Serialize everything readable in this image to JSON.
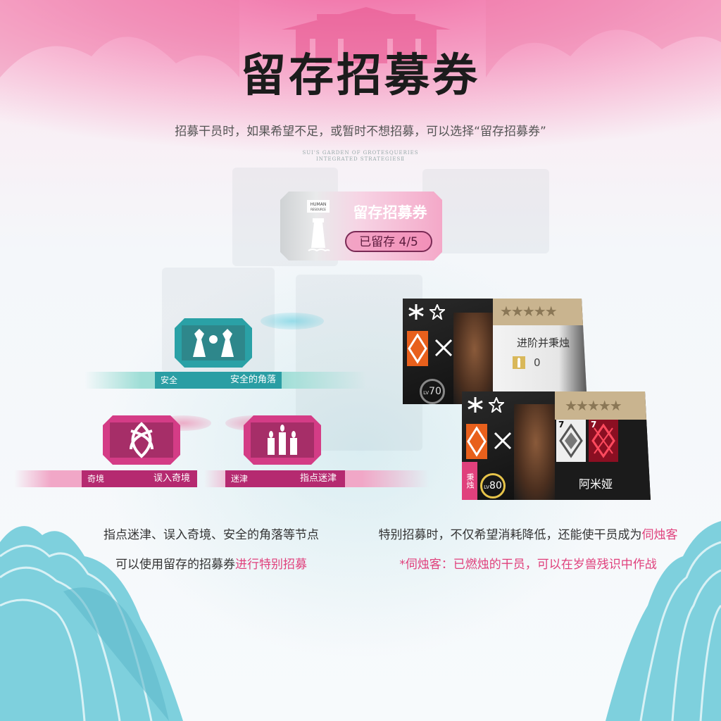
{
  "page": {
    "title": "留存招募券",
    "subtitle": "招募干员时，如果希望不足，或暂时不想招募，可以选择“留存招募券”",
    "tiny_line1": "SUI'S GARDEN OF GROTESQUERIES",
    "tiny_line2": "INTEGRATED    STRATEGIESⅡ"
  },
  "ticket": {
    "logo_text1": "HUMAN",
    "logo_text2": "RESOURCE",
    "name": "留存招募券",
    "status": "已留存 4/5"
  },
  "nodes": {
    "safe_corner": {
      "glyph": "安全",
      "label": "安全的角落",
      "color": "#2a9ea4"
    },
    "wonderland": {
      "glyph": "奇境",
      "label": "误入奇境",
      "color": "#c8307a"
    },
    "guide": {
      "glyph": "迷津",
      "label": "指点迷津",
      "color": "#c8307a"
    }
  },
  "cards": {
    "card1": {
      "stars": "★★★★★",
      "line": "进阶并秉烛",
      "candle": "0",
      "level": "70",
      "lv": "LV"
    },
    "card2": {
      "stars": "★★★★★",
      "name": "阿米娅",
      "level": "80",
      "lv": "LV",
      "badge1": "7",
      "badge2": "7",
      "tag": "秉烛"
    }
  },
  "captions": {
    "left1": "指点迷津、误入奇境、安全的角落等节点",
    "left2a": "可以使用留存的招募券",
    "left2b": "进行特别招募",
    "right1a": "特别招募时，不仅希望消耗降低，还能使干员成为",
    "right1b": "伺烛客",
    "right2": "*伺烛客：已燃烛的干员，可以在岁兽残识中作战"
  },
  "colors": {
    "accent_pink": "#e0407c",
    "teal": "#2a9ea4",
    "magenta": "#c8307a"
  }
}
